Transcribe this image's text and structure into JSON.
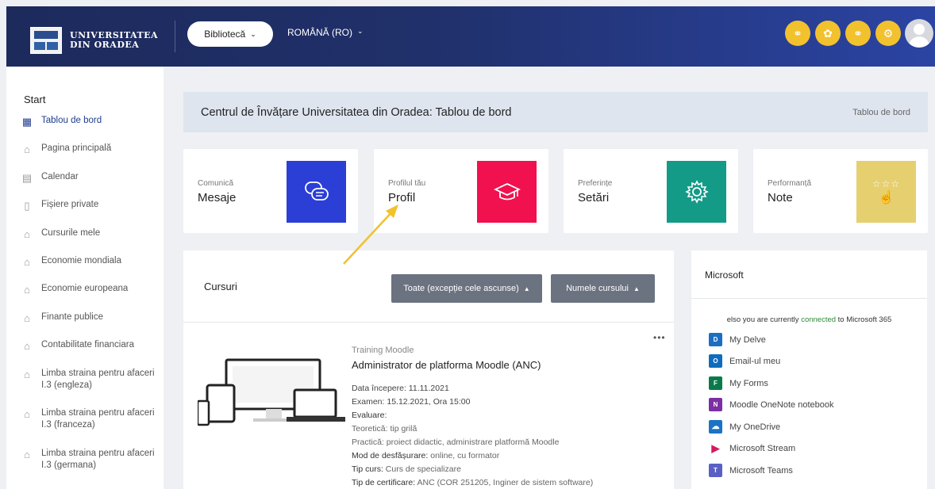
{
  "header": {
    "logo_line1": "UNIVERSITATEA",
    "logo_line2": "DIN ORADEA",
    "library_label": "Bibliotecă",
    "language_label": "ROMÂNĂ (RO)",
    "icons": [
      "link-icon",
      "bug-icon",
      "link-icon",
      "gear-icon"
    ],
    "accent_color": "#f2c12e"
  },
  "sidebar": {
    "start_label": "Start",
    "items": [
      {
        "label": "Tablou de bord",
        "icon": "dashboard-icon",
        "active": true
      },
      {
        "label": "Pagina principală",
        "icon": "home-icon"
      },
      {
        "label": "Calendar",
        "icon": "calendar-icon"
      },
      {
        "label": "Fișiere private",
        "icon": "file-icon"
      },
      {
        "label": "Cursurile mele",
        "icon": "graduation-cap-icon"
      },
      {
        "label": "Economie mondiala",
        "icon": "graduation-cap-icon"
      },
      {
        "label": "Economie europeana",
        "icon": "graduation-cap-icon"
      },
      {
        "label": "Finante publice",
        "icon": "graduation-cap-icon"
      },
      {
        "label": "Contabilitate financiara",
        "icon": "graduation-cap-icon"
      },
      {
        "label": "Limba straina pentru afaceri I.3 (engleza)",
        "icon": "graduation-cap-icon"
      },
      {
        "label": "Limba straina pentru afaceri I.3 (franceza)",
        "icon": "graduation-cap-icon"
      },
      {
        "label": "Limba straina pentru afaceri I.3 (germana)",
        "icon": "graduation-cap-icon"
      }
    ]
  },
  "page": {
    "title": "Centrul de Învățare Universitatea din Oradea: Tablou de bord",
    "breadcrumb": "Tablou de bord"
  },
  "cards": [
    {
      "small": "Comunică",
      "big": "Mesaje",
      "color": "#2b3fd6",
      "icon": "chat-icon"
    },
    {
      "small": "Profilul tău",
      "big": "Profil",
      "color": "#f0114e",
      "icon": "graduation-cap-icon"
    },
    {
      "small": "Preferințe",
      "big": "Setări",
      "color": "#139b87",
      "icon": "gear-icon"
    },
    {
      "small": "Performanță",
      "big": "Note",
      "color": "#e6cf6e",
      "icon": "rating-hand-icon"
    }
  ],
  "courses": {
    "title": "Cursuri",
    "filter_label": "Toate (excepție cele ascunse)",
    "sort_label": "Numele cursului",
    "more_label": "•••",
    "course": {
      "category": "Training Moodle",
      "name": "Administrator de platforma Moodle (ANC)",
      "details": [
        {
          "k": "",
          "v": "Data începere: 11.11.2021"
        },
        {
          "k": "",
          "v": "Examen: 15.12.2021, Ora 15:00"
        },
        {
          "k": "Evaluare",
          "v": ":"
        },
        {
          "k": "",
          "v": "Teoretică: tip grilă"
        },
        {
          "k": "",
          "v": "Practică: proiect didactic, administrare platformă Moodle"
        },
        {
          "k": "Mod de desfășurare:",
          "v": " online, cu formator"
        },
        {
          "k": "Tip curs:",
          "v": " Curs de specializare"
        },
        {
          "k": "Tip de certificare:",
          "v": " ANC (COR 251205, Inginer de sistem software)"
        }
      ]
    }
  },
  "microsoft": {
    "title": "Microsoft",
    "status_prefix": "elso you are currently ",
    "status_link": "connected",
    "status_suffix": " to Microsoft 365",
    "items": [
      {
        "label": "My Delve",
        "icon": "delve-icon",
        "color": "#1b6ec2",
        "glyph": "D"
      },
      {
        "label": "Email-ul meu",
        "icon": "outlook-icon",
        "color": "#0f6cbd",
        "glyph": "O"
      },
      {
        "label": "My Forms",
        "icon": "forms-icon",
        "color": "#0b7a4b",
        "glyph": "F"
      },
      {
        "label": "Moodle OneNote notebook",
        "icon": "onenote-icon",
        "color": "#7b2fa3",
        "glyph": "N"
      },
      {
        "label": "My OneDrive",
        "icon": "onedrive-icon",
        "color": "#1a73c7",
        "glyph": "☁"
      },
      {
        "label": "Microsoft Stream",
        "icon": "stream-icon",
        "color": "#d41a5e",
        "glyph": "▶"
      },
      {
        "label": "Microsoft Teams",
        "icon": "teams-icon",
        "color": "#5a5fc6",
        "glyph": "T"
      }
    ]
  }
}
